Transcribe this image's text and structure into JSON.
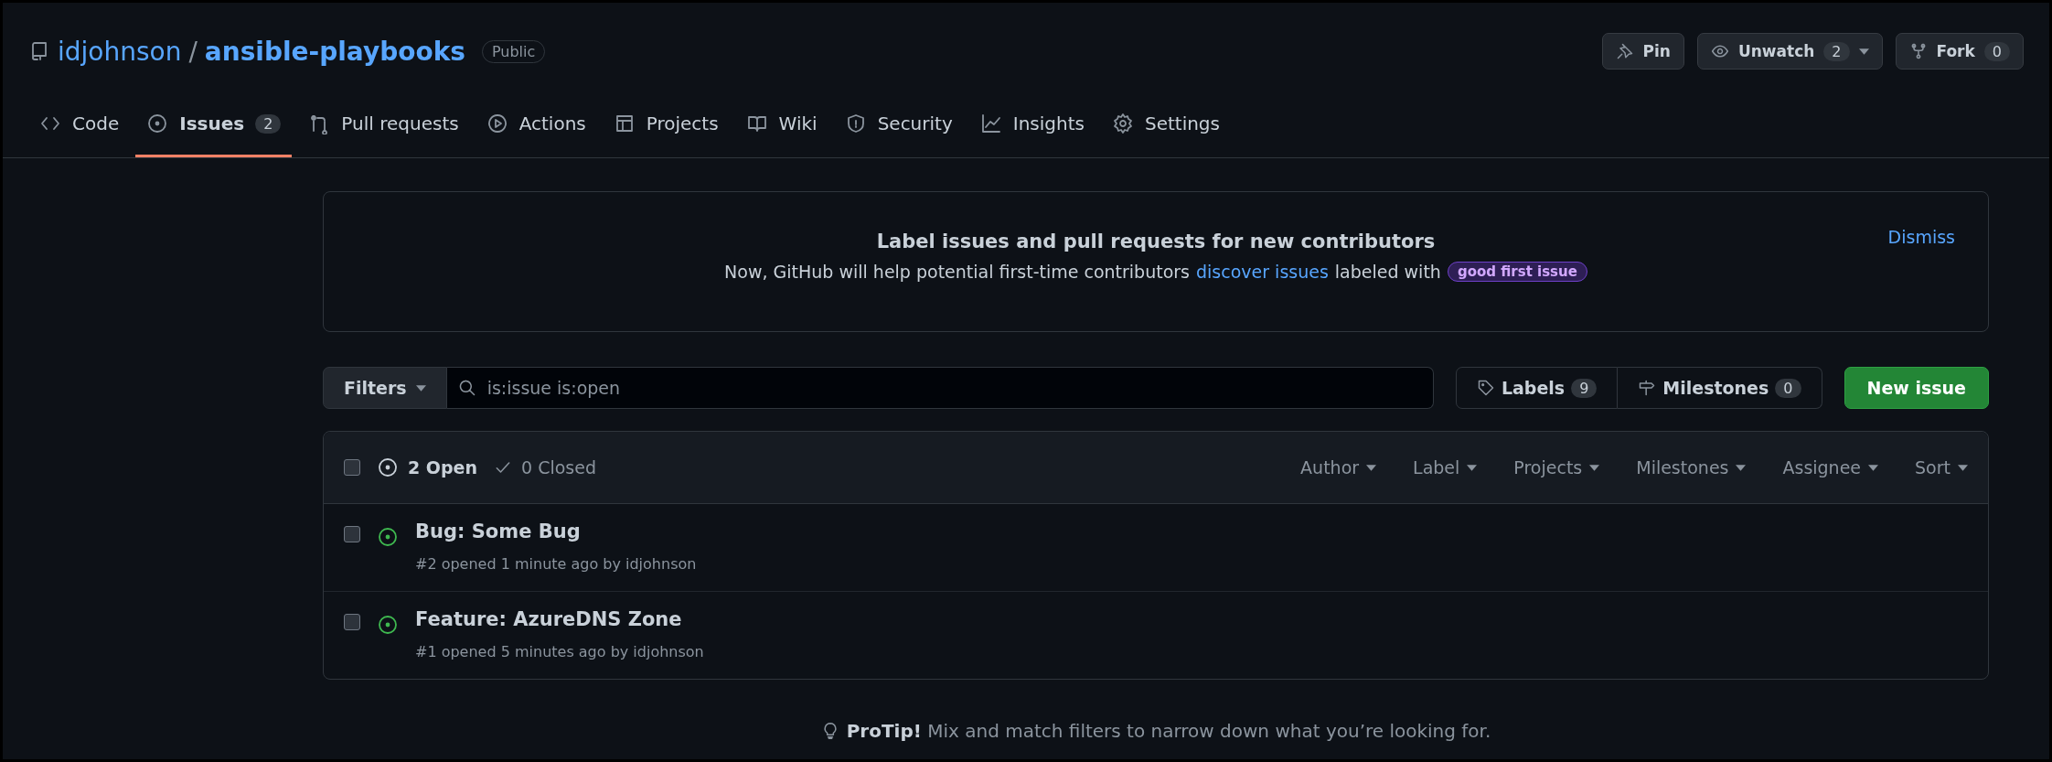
{
  "repo": {
    "owner": "idjohnson",
    "separator": "/",
    "name": "ansible-playbooks",
    "visibility": "Public"
  },
  "actions": [
    {
      "kind": "pin",
      "label": "Pin"
    },
    {
      "kind": "watch",
      "label": "Unwatch",
      "count": "2",
      "dropdown": true
    },
    {
      "kind": "fork",
      "label": "Fork",
      "count": "0",
      "dropdown": false
    }
  ],
  "tabs": [
    {
      "kind": "code",
      "label": "Code",
      "selected": false
    },
    {
      "kind": "issue",
      "label": "Issues",
      "count": "2",
      "selected": true
    },
    {
      "kind": "pull",
      "label": "Pull requests",
      "selected": false
    },
    {
      "kind": "play",
      "label": "Actions",
      "selected": false
    },
    {
      "kind": "table",
      "label": "Projects",
      "selected": false
    },
    {
      "kind": "book",
      "label": "Wiki",
      "selected": false
    },
    {
      "kind": "shield",
      "label": "Security",
      "selected": false
    },
    {
      "kind": "graph",
      "label": "Insights",
      "selected": false
    },
    {
      "kind": "gear",
      "label": "Settings",
      "selected": false
    }
  ],
  "banner": {
    "title": "Label issues and pull requests for new contributors",
    "text": "Now, GitHub will help potential first-time contributors",
    "link": "discover issues",
    "text_after": "labeled with",
    "label": "good first issue",
    "dismiss": "Dismiss"
  },
  "filters": {
    "button": "Filters",
    "search_value": "is:issue is:open",
    "labels": "Labels",
    "labels_count": "9",
    "milestones": "Milestones",
    "milestones_count": "0",
    "new_issue": "New issue"
  },
  "issues_header": {
    "select_all_checked": false,
    "open": "2 Open",
    "closed": "0 Closed",
    "open_selected": true,
    "sorts": [
      "Author",
      "Label",
      "Projects",
      "Milestones",
      "Assignee",
      "Sort"
    ]
  },
  "issues": [
    {
      "title": "Bug: Some Bug",
      "meta": "#2 opened 1 minute ago by idjohnson",
      "checked": false
    },
    {
      "title": "Feature: AzureDNS Zone",
      "meta": "#1 opened 5 minutes ago by idjohnson",
      "checked": false
    }
  ],
  "protip": {
    "lead": "ProTip!",
    "text": "Mix and match filters to narrow down what you’re looking for."
  }
}
